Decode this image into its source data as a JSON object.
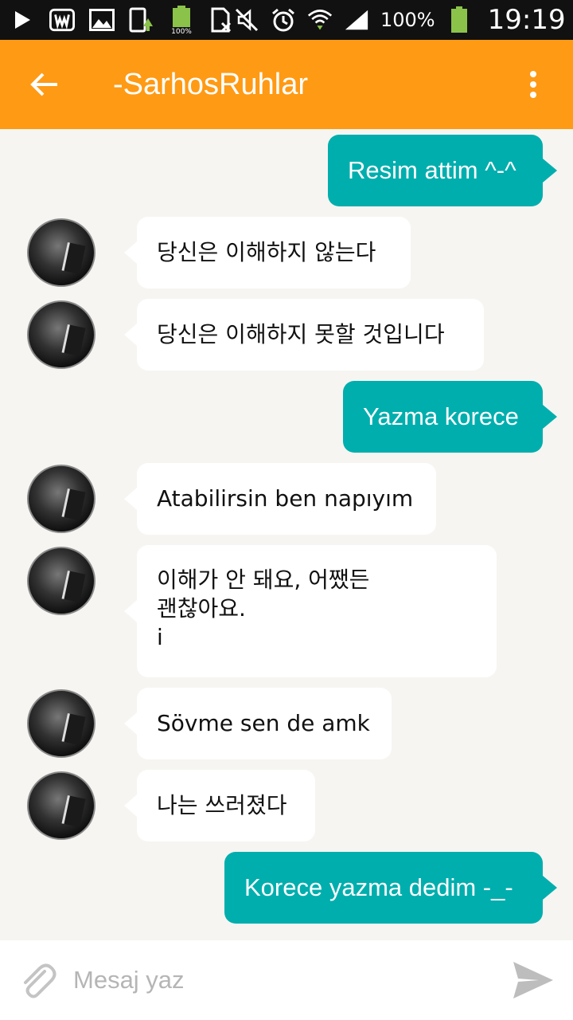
{
  "status_bar": {
    "battery_percent": "100%",
    "battery_small_label": "100%",
    "time": "19:19",
    "icons": [
      "play-icon",
      "w-app-icon",
      "image-icon",
      "update-icon",
      "battery-charge-icon",
      "sim-icon",
      "mute-icon",
      "alarm-icon",
      "wifi-icon",
      "signal-icon",
      "battery-icon"
    ]
  },
  "header": {
    "title": "-SarhosRuhlar",
    "back_icon": "arrow-left-icon",
    "menu_icon": "more-vert-icon",
    "color": "#ff9a14"
  },
  "messages": [
    {
      "direction": "out",
      "text": "Resim attim ^-^"
    },
    {
      "direction": "in",
      "text": "당신은 이해하지 않는다"
    },
    {
      "direction": "in",
      "text": "당신은 이해하지 못할 것입니다"
    },
    {
      "direction": "out",
      "text": "Yazma korece"
    },
    {
      "direction": "in",
      "text": "Atabilirsin ben napıyım"
    },
    {
      "direction": "in",
      "text": "이해가 안 돼요, 어쨌든\n괜찮아요.\ni"
    },
    {
      "direction": "in",
      "text": "Sövme sen de amk"
    },
    {
      "direction": "in",
      "text": "나는 쓰러졌다"
    },
    {
      "direction": "out",
      "text": "Korece yazma dedim -_-"
    }
  ],
  "composer": {
    "placeholder": "Mesaj yaz",
    "value": "",
    "attach_icon": "paperclip-icon",
    "send_icon": "send-icon"
  },
  "colors": {
    "outgoing_bubble": "#00aeae",
    "incoming_bubble": "#ffffff",
    "chat_background": "#f6f5f1"
  }
}
